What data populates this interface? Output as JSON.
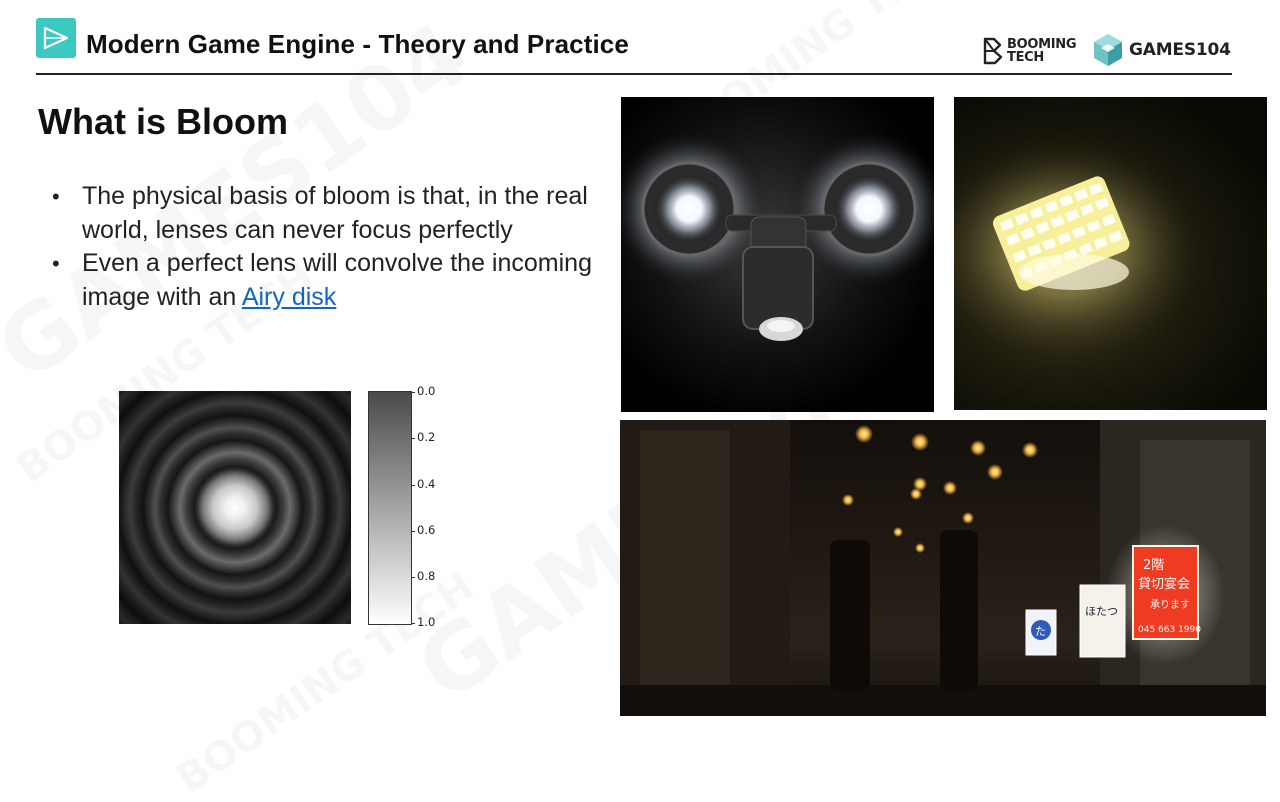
{
  "header": {
    "title": "Modern Game Engine - Theory and Practice",
    "brand_left_line1": "BOOMING",
    "brand_left_line2": "TECH",
    "brand_right": "GAMES104",
    "accent_color": "#3cc9c0"
  },
  "slide": {
    "title": "What is Bloom",
    "bullets": [
      {
        "text": "The physical basis of bloom is that, in the real world, lenses can never focus perfectly"
      },
      {
        "text_before": "Even a perfect lens will convolve the incoming image with an ",
        "link_text": "Airy disk"
      }
    ],
    "link_color": "#1565c0"
  },
  "airy_figure": {
    "colorbar_ticks": [
      "0.0",
      "0.2",
      "0.4",
      "0.6",
      "0.8",
      "1.0"
    ]
  },
  "photos": {
    "street_sign_1_line1": "2階",
    "street_sign_1_line2": "貸切宴会",
    "street_sign_1_line3": "承ります",
    "street_sign_1_phone": "045 663 1990",
    "street_sign_2": "ほたつ",
    "street_sign_3": "た"
  },
  "watermarks": [
    "GAMES104",
    "BOOMING TECH"
  ]
}
